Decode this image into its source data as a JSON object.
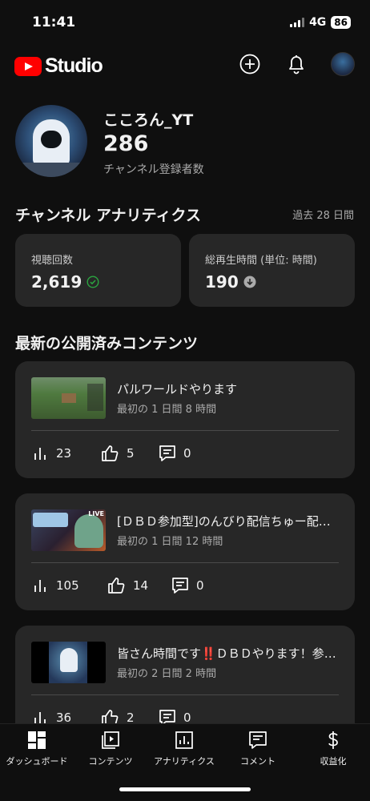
{
  "status_bar": {
    "time": "11:41",
    "network": "4G",
    "battery": "86"
  },
  "header": {
    "logo_text": "Studio",
    "icons": [
      "create-icon",
      "notifications-icon",
      "account-avatar"
    ]
  },
  "channel": {
    "name": "こころん_YT",
    "subscriber_count": "286",
    "subscriber_label": "チャンネル登録者数"
  },
  "analytics": {
    "title": "チャンネル アナリティクス",
    "period": "過去 28 日間",
    "cards": [
      {
        "label": "視聴回数",
        "value": "2,619",
        "indicator": "check-circle-icon",
        "indicator_color": "#2ba640"
      },
      {
        "label": "総再生時間 (単位: 時間)",
        "value": "190",
        "indicator": "arrow-down-circle-icon",
        "indicator_color": "#aaaaaa"
      }
    ]
  },
  "latest": {
    "title": "最新の公開済みコンテンツ",
    "items": [
      {
        "title": "パルワールドやります",
        "subtitle": "最初の 1 日間 8 時間",
        "views": "23",
        "likes": "5",
        "comments": "0"
      },
      {
        "title": "[ＤＢＤ参加型]のんびり配信ちゅー配信中",
        "subtitle": "最初の 1 日間 12 時間",
        "views": "105",
        "likes": "14",
        "comments": "0",
        "thumb_badge": "LIVE"
      },
      {
        "title": "皆さん時間です‼️ＤＢＤやります！参加型",
        "subtitle": "最初の 2 日間 2 時間",
        "views": "36",
        "likes": "2",
        "comments": "0"
      }
    ]
  },
  "bottom_nav": [
    {
      "label": "ダッシュボード",
      "icon": "dashboard-icon"
    },
    {
      "label": "コンテンツ",
      "icon": "content-icon"
    },
    {
      "label": "アナリティクス",
      "icon": "analytics-icon"
    },
    {
      "label": "コメント",
      "icon": "comment-icon"
    },
    {
      "label": "収益化",
      "icon": "dollar-icon"
    }
  ]
}
